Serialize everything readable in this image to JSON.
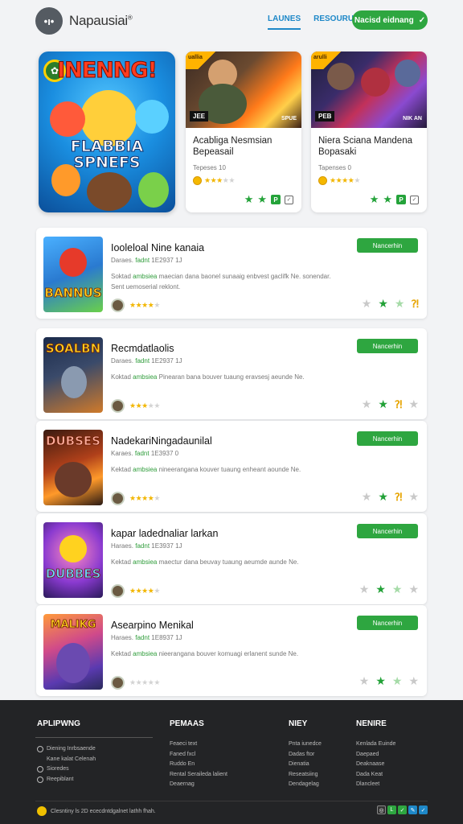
{
  "header": {
    "logo_glyph": "•ı•",
    "brand": "Napausiai",
    "brand_mark": "®",
    "nav": [
      "LAUNES",
      "RESOURUAS"
    ],
    "cta_label": "Nacisd eidnang",
    "cta_icon": "✓"
  },
  "featured": {
    "main": {
      "title": "INENNG!",
      "subtitle_1": "FLABBIA",
      "subtitle_2": "SPNEFS"
    },
    "cards": [
      {
        "title": "Acabliga Nesmsian Bepeasail",
        "meta": "Tepeses 10",
        "image_tag": "JEE",
        "image_tag2": "SPUE",
        "corner": "uallia",
        "stars": 3,
        "star_display": "★★★★★"
      },
      {
        "title": "Niera Sciana Mandena Bopasaki",
        "meta": "Tapenses 0",
        "image_tag": "PEB",
        "image_tag2": "NIK AN",
        "corner": "arulli",
        "stars": 4,
        "star_display": "★★★★★"
      }
    ]
  },
  "list": [
    {
      "title": "Iooleloal Nine kanaia",
      "meta_pre": "Daraes.",
      "meta_hl": "fadnt",
      "meta_post": "1E2937  1J",
      "desc_pre": "Soktad",
      "desc_hl": "ambsiea",
      "desc_post": "maecian dana baonel sunaaig enbvest gaclifk Ne. sonendar. Sent uemoserial reklont.",
      "thumb_text": "BANNUS",
      "button": "Nancerhin",
      "stars": 4,
      "star_display": "★★★★★"
    },
    {
      "title": "Recmdatlaolis",
      "meta_pre": "Daraes.",
      "meta_hl": "fadnt",
      "meta_post": "1E2937  1J",
      "desc_pre": "Koktad",
      "desc_hl": "ambsiea",
      "desc_post": "Pinearan bana bouver tuaung eravsesj aeunde Ne.",
      "thumb_text": "SOALBN",
      "button": "Nancerhin",
      "stars": 3,
      "star_display": "★★★★★"
    },
    {
      "title": "NadekariNingadaunilal",
      "meta_pre": "Karaes.",
      "meta_hl": "fadnt",
      "meta_post": "1E3937  0",
      "desc_pre": "Kektad",
      "desc_hl": "ambsiea",
      "desc_post": "nineerangana kouver tuaung enheant aounde Ne.",
      "thumb_text": "DUBSES",
      "button": "Nancerhin",
      "stars": 4,
      "star_display": "★★★★★"
    },
    {
      "title": "kapar ladednaliar larkan",
      "meta_pre": "Haraes.",
      "meta_hl": "fadnt",
      "meta_post": "1E3937  1J",
      "desc_pre": "Kektad",
      "desc_hl": "ambsiea",
      "desc_post": "maectur dana beuvay tuaung aeumde aunde Ne.",
      "thumb_text": "DUBBES",
      "button": "Nancerhin",
      "stars": 4,
      "star_display": "★★★★★"
    },
    {
      "title": "Asearpino Menikal",
      "meta_pre": "Haraes.",
      "meta_hl": "fadnt",
      "meta_post": "1E8937  1J",
      "desc_pre": "Kektad",
      "desc_hl": "ambsiea",
      "desc_post": "nieerangana bouver komuagi erlanent sunde Ne.",
      "thumb_text": "MALIKG",
      "button": "Nancerhin",
      "stars": 0,
      "star_display": "★★★★★"
    }
  ],
  "footer": {
    "col1": {
      "heading": "APLIPWNG",
      "links": [
        "Diening Inrbsaende",
        "Kane kalat Celenah",
        "Sioredes",
        "Reepiblant"
      ]
    },
    "col2": {
      "heading": "PEMAAS",
      "links": [
        "Feaeci text",
        "Faned fxcl",
        "Ruddo En",
        "Rental Seraileda lalient",
        "Deaernag"
      ]
    },
    "col3": {
      "heading": "NIEY",
      "links": [
        "Pnta iunedce",
        "Dadas ftor",
        "Dienatia",
        "Reseatsiing",
        "Dendagelag"
      ]
    },
    "col4": {
      "heading": "NENIRE",
      "links": [
        "Kenlada Euinde",
        "Daepaed",
        "Deaknaase",
        "Dada Keat",
        "Dlancleet"
      ]
    },
    "copyright": "Clesntiny ls 2D ececdntdgalnet lathh fhah."
  },
  "colors": {
    "green": "#2ea640",
    "blue": "#1e88c8",
    "footer_bg": "#232426"
  }
}
